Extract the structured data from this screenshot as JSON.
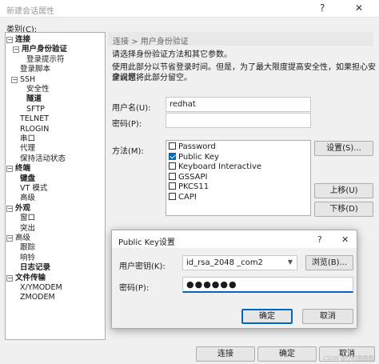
{
  "window": {
    "title": "新建会话属性",
    "help": "?",
    "close": "✕"
  },
  "category_label": "类别(C):",
  "tree": [
    {
      "label": "连接",
      "bold": true,
      "expander": "−"
    },
    {
      "label": "用户身份验证",
      "bold": true,
      "selected": true,
      "expander": "−"
    },
    {
      "label": "登录提示符"
    },
    {
      "label": "登录脚本"
    },
    {
      "label": "SSH",
      "expander": "−"
    },
    {
      "label": "安全性"
    },
    {
      "label": "隧道",
      "bold": true
    },
    {
      "label": "SFTP"
    },
    {
      "label": "TELNET"
    },
    {
      "label": "RLOGIN"
    },
    {
      "label": "串口"
    },
    {
      "label": "代理"
    },
    {
      "label": "保持活动状态"
    },
    {
      "label": "终端",
      "bold": true,
      "expander": "−"
    },
    {
      "label": "键盘",
      "bold": true
    },
    {
      "label": "VT 模式"
    },
    {
      "label": "高级"
    },
    {
      "label": "外观",
      "bold": true,
      "expander": "−"
    },
    {
      "label": "窗口"
    },
    {
      "label": "突出"
    },
    {
      "label": "高级",
      "expander": "−"
    },
    {
      "label": "跟踪"
    },
    {
      "label": "响铃"
    },
    {
      "label": "日志记录",
      "bold": true
    },
    {
      "label": "文件传输",
      "bold": true,
      "expander": "−"
    },
    {
      "label": "X/YMODEM"
    },
    {
      "label": "ZMODEM"
    }
  ],
  "breadcrumb": "连接 > 用户身份验证",
  "description": {
    "line1": "请选择身份验证方法和其它参数。",
    "line2": "使用此部分以节省登录时间。但是，为了最大限度提高安全性，如果担心安全问题，",
    "line3": "建议您将此部分留空。"
  },
  "form": {
    "username_label": "用户名(U):",
    "username_value": "redhat",
    "password_label": "密码(P):",
    "password_value": "",
    "method_label": "方法(M):"
  },
  "methods": [
    {
      "label": "Password",
      "checked": false
    },
    {
      "label": "Public Key",
      "checked": true
    },
    {
      "label": "Keyboard Interactive",
      "checked": false
    },
    {
      "label": "GSSAPI",
      "checked": false
    },
    {
      "label": "PKCS11",
      "checked": false
    },
    {
      "label": "CAPI",
      "checked": false
    }
  ],
  "side_buttons": {
    "settings": "设置(S)...",
    "move_up": "上移(U)",
    "move_down": "下移(D)"
  },
  "dialog": {
    "title": "Public Key设置",
    "help": "?",
    "close": "✕",
    "user_key_label": "用户密钥(K):",
    "user_key_value": "id_rsa_2048 _com2",
    "browse": "浏览(B)...",
    "password_label": "密码(P):",
    "password_value": "●●●●●●",
    "ok": "确定",
    "cancel": "取消"
  },
  "footer": {
    "connect": "连接",
    "ok": "确定",
    "cancel": "取消"
  },
  "watermark": "CSDN @小时酷酷酷"
}
